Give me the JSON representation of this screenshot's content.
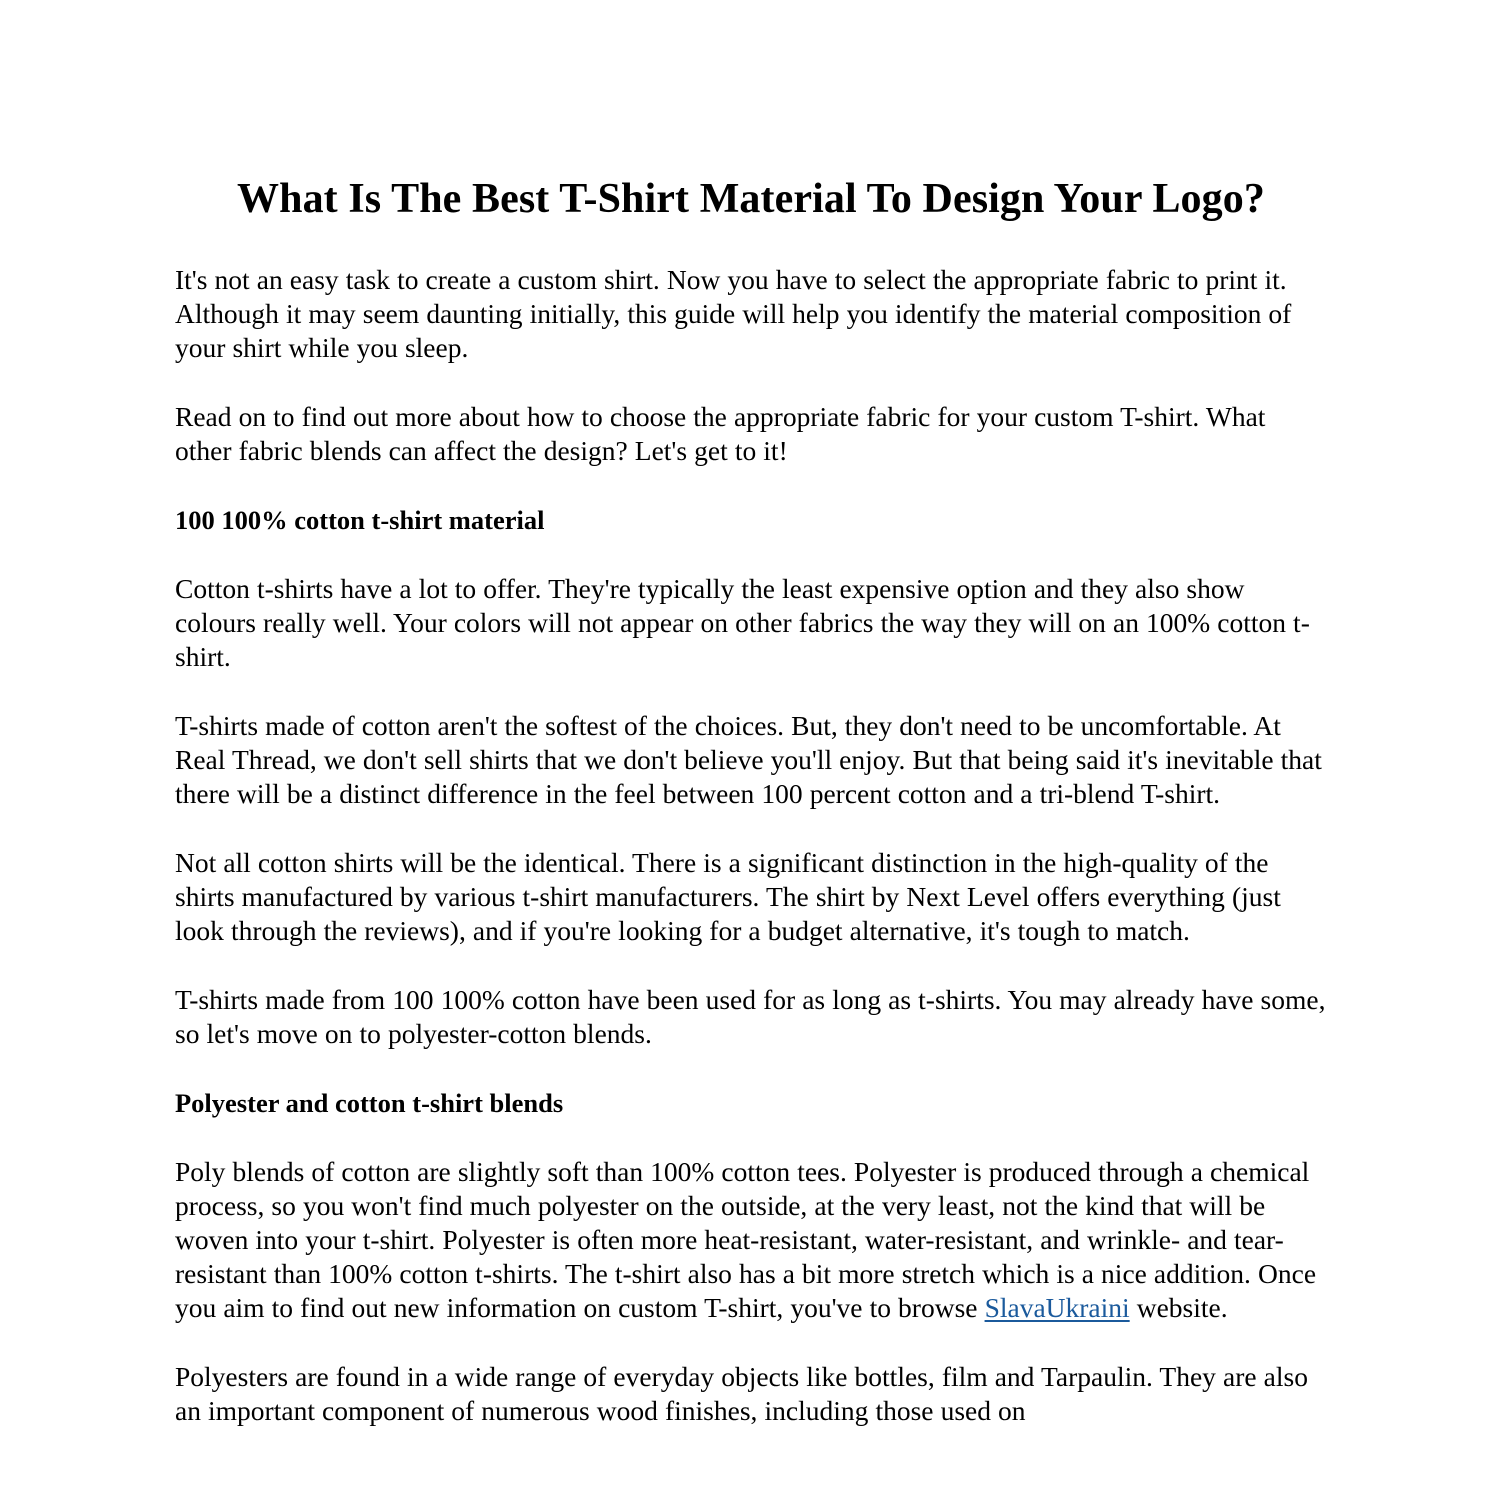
{
  "document": {
    "title": "What Is The Best T-Shirt Material To Design Your Logo?",
    "link_color": "#1b5a9c",
    "text_color": "#000000",
    "background_color": "#ffffff"
  },
  "body": {
    "paragraph_1": "It's not an easy task to create a custom shirt. Now you have to select the appropriate fabric to print it. Although it may seem daunting initially, this guide will help you identify the material composition of your shirt while you sleep.",
    "paragraph_2": "Read on to find out more about how to choose the appropriate fabric for your custom T-shirt. What other fabric blends can affect the design? Let's get to it!",
    "heading_1": "100 100% cotton t-shirt material",
    "paragraph_3": "Cotton t-shirts have a lot to offer. They're typically the least expensive option and they also show colours really well. Your colors will not appear on other fabrics the way they will on an 100% cotton t-shirt.",
    "paragraph_4": "T-shirts made of cotton aren't the softest of the choices. But, they don't need to be uncomfortable. At Real Thread, we don't sell shirts that we don't believe you'll enjoy. But that being said it's inevitable that there will be a distinct difference in the feel between 100 percent cotton and a tri-blend T-shirt.",
    "paragraph_5": "Not all cotton shirts will be the identical. There is a significant distinction in the high-quality of the shirts manufactured by various t-shirt manufacturers. The shirt by Next Level offers everything (just look through the reviews), and if you're looking for a budget alternative, it's tough to match.",
    "paragraph_6": "T-shirts made from 100 100% cotton have been used for as long as t-shirts. You may already have some, so let's move on to polyester-cotton blends.",
    "heading_2": "Polyester and cotton t-shirt blends",
    "paragraph_7_part_a": "Poly blends of cotton are slightly soft than 100% cotton tees. Polyester is produced through a chemical process, so you won't find much polyester on the outside, at the very least, not the kind that will be woven into your t-shirt. Polyester is often more heat-resistant, water-resistant, and wrinkle- and tear-resistant than 100% cotton t-shirts. The t-shirt also has a bit more stretch which is a nice addition. Once you aim to find out new information on custom T-shirt, you've to browse ",
    "paragraph_7_link": "SlavaUkraini",
    "paragraph_7_part_b": " website.",
    "paragraph_8": "Polyesters are found in a wide range of everyday objects like bottles, film and Tarpaulin. They are also an important component of numerous wood finishes, including those used on"
  }
}
